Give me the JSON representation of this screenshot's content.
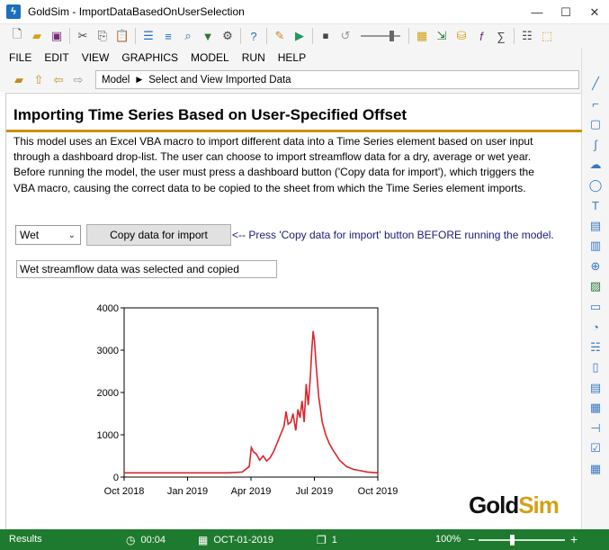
{
  "window": {
    "app_name": "GoldSim",
    "separator": "-",
    "file_name": "ImportDataBasedOnUserSelection",
    "minimize": "—",
    "maximize": "☐",
    "close": "✕"
  },
  "menu": [
    "FILE",
    "EDIT",
    "VIEW",
    "GRAPHICS",
    "MODEL",
    "RUN",
    "HELP"
  ],
  "breadcrumb": {
    "root": "Model",
    "arrow": "▶",
    "current": "Select and View Imported Data"
  },
  "content": {
    "heading": "Importing Time Series Based on User-Specified Offset",
    "description": "This model uses an Excel VBA macro to import different data into a Time Series element based on user input through a dashboard drop-list. The user can choose to import streamflow data for a dry, average or wet year. Before running the model, the user must press a dashboard button ('Copy data for import'), which triggers the VBA macro, causing the correct data to be copied to the sheet from which the Time Series element imports.",
    "dropdown_value": "Wet",
    "copy_button_label": "Copy data for import",
    "hint": "<-- Press 'Copy data for import' button BEFORE running the model.",
    "status_text": "Wet streamflow data was selected and copied"
  },
  "logo": {
    "part1": "Gold",
    "part2": "Sim"
  },
  "statusbar": {
    "mode": "Results",
    "elapsed": "00:04",
    "date": "OCT-01-2019",
    "realization": "1",
    "zoom": "100%",
    "zoom_minus": "−",
    "zoom_plus": "+",
    "zoom_level": 0.38
  },
  "colors": {
    "accent_rule": "#c9910c",
    "series_line": "#d9262b",
    "statusbar": "#1e7a2e",
    "hint_text": "#1a1a7a"
  },
  "chart_data": {
    "type": "line",
    "title": "",
    "xlabel": "",
    "ylabel": "",
    "x_ticks": [
      "Oct 2018",
      "Jan 2019",
      "Apr 2019",
      "Jul 2019",
      "Oct 2019"
    ],
    "y_ticks": [
      "0",
      "1000",
      "2000",
      "3000",
      "4000"
    ],
    "xlim": [
      0,
      365
    ],
    "ylim": [
      0,
      4000
    ],
    "grid": false,
    "legend": "none",
    "series": [
      {
        "x": [
          0,
          30,
          60,
          90,
          120,
          150,
          170,
          180,
          183,
          186,
          190,
          195,
          200,
          205,
          210,
          215,
          220,
          225,
          230,
          233,
          236,
          240,
          243,
          247,
          250,
          253,
          256,
          259,
          262,
          265,
          268,
          270,
          272,
          274,
          276,
          280,
          285,
          290,
          295,
          300,
          310,
          320,
          330,
          340,
          350,
          365
        ],
        "values": [
          100,
          100,
          100,
          100,
          100,
          100,
          120,
          250,
          700,
          600,
          550,
          400,
          500,
          380,
          450,
          600,
          800,
          1000,
          1200,
          1550,
          1250,
          1300,
          1500,
          1100,
          1600,
          1400,
          1800,
          1300,
          2200,
          1700,
          2400,
          3000,
          3450,
          3200,
          2700,
          1900,
          1300,
          1000,
          800,
          650,
          400,
          250,
          180,
          150,
          120,
          100
        ]
      }
    ]
  }
}
